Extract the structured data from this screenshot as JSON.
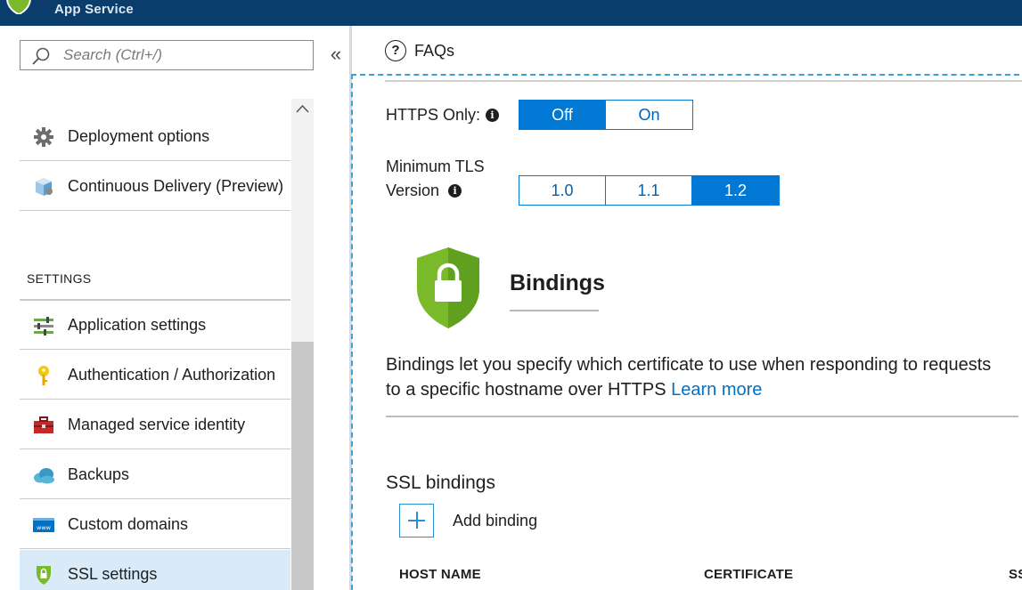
{
  "app": {
    "title": "App Service",
    "icon": "app-service-shield-icon"
  },
  "search": {
    "placeholder": "Search (Ctrl+/)",
    "icon": "search-icon"
  },
  "collapse": {
    "label": "«",
    "icon": "double-chevron-left-icon"
  },
  "sidebar": {
    "items_top": [
      {
        "label": "Deployment options",
        "icon": "gear-icon"
      },
      {
        "label": "Continuous Delivery (Preview)",
        "icon": "cube-icon"
      }
    ],
    "section_settings": "SETTINGS",
    "items_settings": [
      {
        "label": "Application settings",
        "icon": "sliders-icon"
      },
      {
        "label": "Authentication / Authorization",
        "icon": "key-icon"
      },
      {
        "label": "Managed service identity",
        "icon": "toolbox-icon"
      },
      {
        "label": "Backups",
        "icon": "cloud-icon"
      },
      {
        "label": "Custom domains",
        "icon": "www-icon"
      },
      {
        "label": "SSL settings",
        "icon": "shield-icon",
        "selected": true
      }
    ]
  },
  "toolbar": {
    "faqs_label": "FAQs",
    "faqs_icon": "question-circle-icon",
    "faqs_symbol": "?"
  },
  "https_only": {
    "label": "HTTPS Only:",
    "info_symbol": "i",
    "options": [
      "Off",
      "On"
    ],
    "selected": "Off"
  },
  "min_tls": {
    "label_line1": "Minimum TLS",
    "label_line2": "Version",
    "info_symbol": "i",
    "options": [
      "1.0",
      "1.1",
      "1.2"
    ],
    "selected": "1.2"
  },
  "bindings": {
    "title": "Bindings",
    "icon": "green-shield-lock-icon",
    "description": "Bindings let you specify which certificate to use when responding to requests to a specific hostname over HTTPS",
    "learn_more": "Learn more"
  },
  "ssl_bindings": {
    "title": "SSL bindings",
    "add_label": "Add binding",
    "columns": [
      "HOST NAME",
      "CERTIFICATE",
      "SS"
    ]
  },
  "colors": {
    "topbar": "#0a3d6b",
    "accent": "#0078d4",
    "selected_bg": "#d9ebf9",
    "shield_green": "#7ab929",
    "link": "#0072c6"
  }
}
